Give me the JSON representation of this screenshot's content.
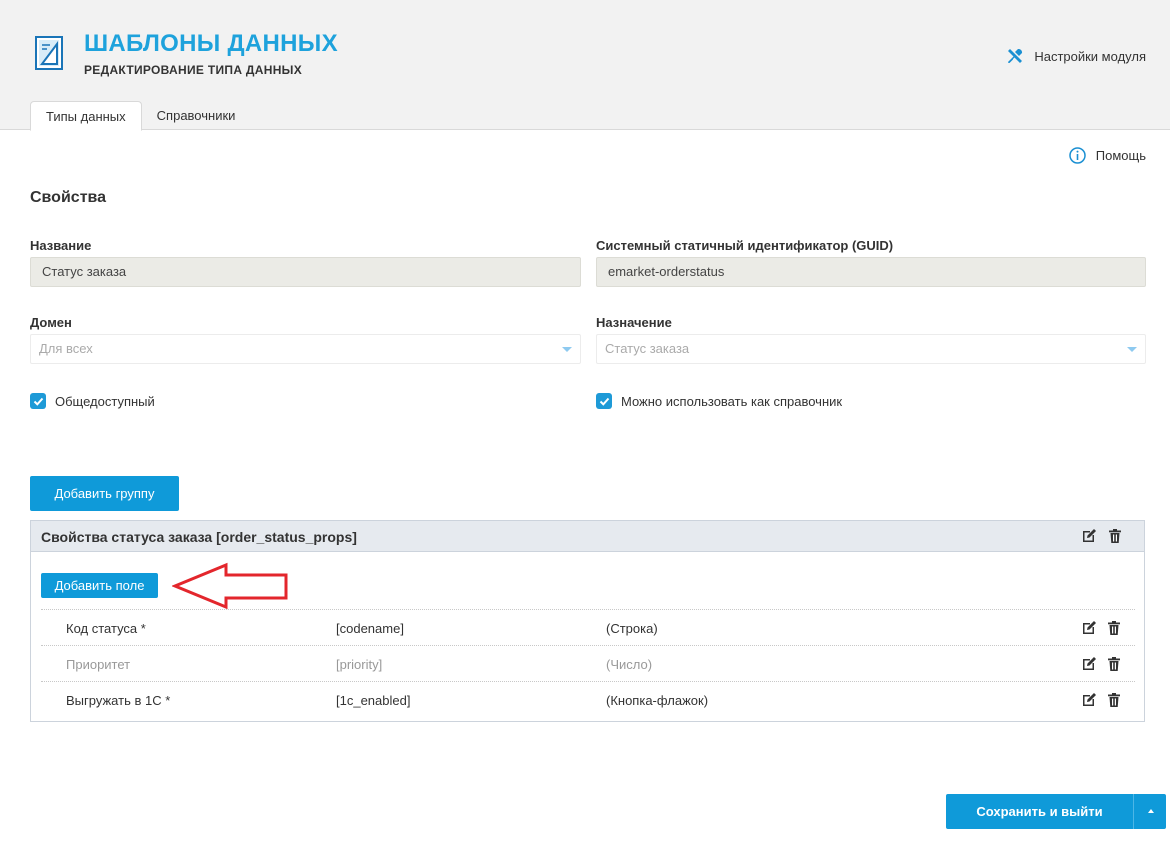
{
  "header": {
    "title": "ШАБЛОНЫ ДАННЫХ",
    "subtitle": "РЕДАКТИРОВАНИЕ ТИПА ДАННЫХ",
    "settings_label": "Настройки модуля",
    "logo_icon": "data-templates-logo-icon",
    "settings_icon": "tools-icon"
  },
  "tabs": [
    {
      "label": "Типы данных",
      "active": true
    },
    {
      "label": "Справочники",
      "active": false
    }
  ],
  "help_label": "Помощь",
  "properties": {
    "section_title": "Свойства",
    "name_label": "Название",
    "name_value": "Статус заказа",
    "guid_label": "Системный статичный идентификатор (GUID)",
    "guid_value": "emarket-orderstatus",
    "domain_label": "Домен",
    "domain_value": "Для всех",
    "purpose_label": "Назначение",
    "purpose_value": "Статус заказа",
    "public_label": "Общедоступный",
    "public_checked": true,
    "guide_label": "Можно использовать как справочник",
    "guide_checked": true
  },
  "add_group_label": "Добавить группу",
  "group": {
    "title": "Свойства статуса заказа [order_status_props]",
    "add_field_label": "Добавить поле",
    "fields": [
      {
        "name": "Код статуса *",
        "code": "[codename]",
        "type": "(Строка)",
        "muted": false
      },
      {
        "name": "Приоритет",
        "code": "[priority]",
        "type": "(Число)",
        "muted": true
      },
      {
        "name": "Выгружать в 1С *",
        "code": "[1c_enabled]",
        "type": "(Кнопка-флажок)",
        "muted": false
      }
    ]
  },
  "save_label": "Сохранить и выйти",
  "colors": {
    "accent": "#1ea2dc",
    "button": "#0f9ad9",
    "arrow": "#e3262c"
  }
}
